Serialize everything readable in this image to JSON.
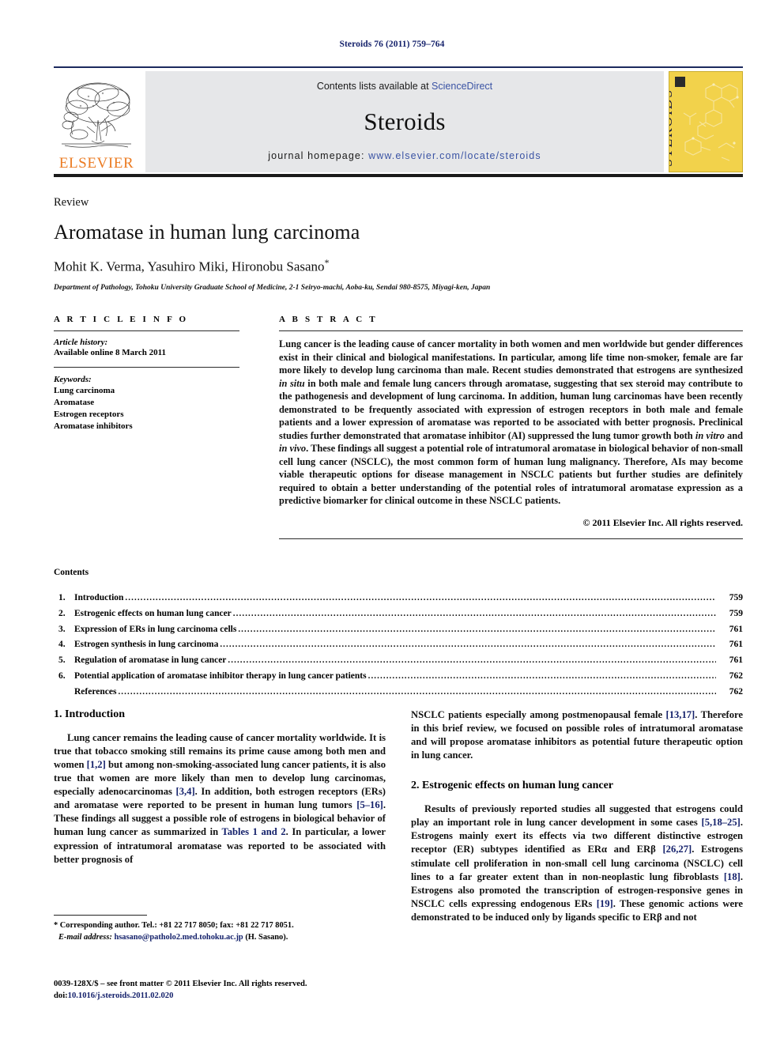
{
  "running_head": "Steroids 76 (2011) 759–764",
  "masthead": {
    "publisher_logo_word": "ELSEVIER",
    "contents_line_prefix": "Contents lists available at ",
    "contents_line_link": "ScienceDirect",
    "journal_name": "Steroids",
    "homepage_prefix": "journal homepage: ",
    "homepage_link": "www.elsevier.com/locate/steroids",
    "cover_title": "STEROIDS",
    "accent_cover_color": "#f2d24b",
    "accent_rule_color": "#1c2a5e",
    "link_color": "#3a53a4"
  },
  "title_block": {
    "doc_type": "Review",
    "title": "Aromatase in human lung carcinoma",
    "authors": "Mohit K. Verma, Yasuhiro Miki, Hironobu Sasano",
    "corresponding_marker": "*",
    "affiliation": "Department of Pathology, Tohoku University Graduate School of Medicine, 2-1 Seiryo-machi, Aoba-ku, Sendai 980-8575, Miyagi-ken, Japan"
  },
  "article_info": {
    "heading": "A R T I C L E    I N F O",
    "history_label": "Article history:",
    "history_value": "Available online 8 March 2011",
    "keywords_label": "Keywords:",
    "keywords": [
      "Lung carcinoma",
      "Aromatase",
      "Estrogen receptors",
      "Aromatase inhibitors"
    ]
  },
  "abstract": {
    "heading": "A B S T R A C T",
    "part1": "Lung cancer is the leading cause of cancer mortality in both women and men worldwide but gender differences exist in their clinical and biological manifestations. In particular, among life time non-smoker, female are far more likely to develop lung carcinoma than male. Recent studies demonstrated that estrogens are synthesized ",
    "italic1": "in situ",
    "part2": " in both male and female lung cancers through aromatase, suggesting that sex steroid may contribute to the pathogenesis and development of lung carcinoma. In addition, human lung carcinomas have been recently demonstrated to be frequently associated with expression of estrogen receptors in both male and female patients and a lower expression of aromatase was reported to be associated with better prognosis. Preclinical studies further demonstrated that aromatase inhibitor (AI) suppressed the lung tumor growth both ",
    "italic2": "in vitro",
    "part3": " and ",
    "italic3": "in vivo",
    "part4": ". These findings all suggest a potential role of intratumoral aromatase in biological behavior of non-small cell lung cancer (NSCLC), the most common form of human lung malignancy. Therefore, AIs may become viable therapeutic options for disease management in NSCLC patients but further studies are definitely required to obtain a better understanding of the potential roles of intratumoral aromatase expression as a predictive biomarker for clinical outcome in these NSCLC patients.",
    "copyright": "© 2011 Elsevier Inc. All rights reserved."
  },
  "contents": {
    "title": "Contents",
    "rows": [
      {
        "num": "1.",
        "label": "Introduction",
        "page": "759"
      },
      {
        "num": "2.",
        "label": "Estrogenic effects on human lung cancer",
        "page": "759"
      },
      {
        "num": "3.",
        "label": "Expression of ERs in lung carcinoma cells",
        "page": "761"
      },
      {
        "num": "4.",
        "label": "Estrogen synthesis in lung carcinoma",
        "page": "761"
      },
      {
        "num": "5.",
        "label": "Regulation of aromatase in lung cancer",
        "page": "761"
      },
      {
        "num": "6.",
        "label": "Potential application of aromatase inhibitor therapy in lung cancer patients",
        "page": "762"
      },
      {
        "num": "",
        "label": "References",
        "page": "762"
      }
    ],
    "dots": "........................................................................................................................................................................................................................................................................................"
  },
  "body": {
    "section1_title": "1.  Introduction",
    "left_p1_a": "Lung cancer remains the leading cause of cancer mortality worldwide. It is true that tobacco smoking still remains its prime cause among both men and women ",
    "left_p1_ref1": "[1,2]",
    "left_p1_b": " but among non-smoking-associated lung cancer patients, it is also true that women are more likely than men to develop lung carcinomas, especially adenocarcinomas ",
    "left_p1_ref2": "[3,4]",
    "left_p1_c": ". In addition, both estrogen receptors (ERs) and aromatase were reported to be present in human lung tumors ",
    "left_p1_ref3": "[5–16]",
    "left_p1_d": ". These findings all suggest a possible role of estrogens in biological behavior of human lung cancer as summarized in ",
    "left_p1_ref4": "Tables 1 and 2",
    "left_p1_e": ". In particular, a lower expression of intratumoral aromatase was reported to be associated with better prognosis of",
    "right_p1_a": "NSCLC patients especially among postmenopausal female ",
    "right_p1_ref1": "[13,17]",
    "right_p1_b": ". Therefore in this brief review, we focused on possible roles of intratumoral aromatase and will propose aromatase inhibitors as potential future therapeutic option in lung cancer.",
    "section2_title": "2.  Estrogenic effects on human lung cancer",
    "right_p2_a": "Results of previously reported studies all suggested that estrogens could play an important role in lung cancer development in some cases ",
    "right_p2_ref1": "[5,18–25]",
    "right_p2_b": ". Estrogens mainly exert its effects via two different distinctive estrogen receptor (ER) subtypes identified as ERα and ERβ ",
    "right_p2_ref2": "[26,27]",
    "right_p2_c": ". Estrogens stimulate cell proliferation in non-small cell lung carcinoma (NSCLC) cell lines to a far greater extent than in non-neoplastic lung fibroblasts ",
    "right_p2_ref3": "[18]",
    "right_p2_d": ". Estrogens also promoted the transcription of estrogen-responsive genes in NSCLC cells expressing endogenous ERs ",
    "right_p2_ref4": "[19]",
    "right_p2_e": ". These genomic actions were demonstrated to be induced only by ligands specific to ERβ and not"
  },
  "footnotes": {
    "corresponding": "* Corresponding author. Tel.: +81 22 717 8050; fax: +81 22 717 8051.",
    "email_label": "E-mail address:",
    "email_value": "hsasano@patholo2.med.tohoku.ac.jp",
    "email_suffix": " (H. Sasano).",
    "issn_line": "0039-128X/$ – see front matter © 2011 Elsevier Inc. All rights reserved.",
    "doi_label": "doi:",
    "doi_value": "10.1016/j.steroids.2011.02.020"
  }
}
